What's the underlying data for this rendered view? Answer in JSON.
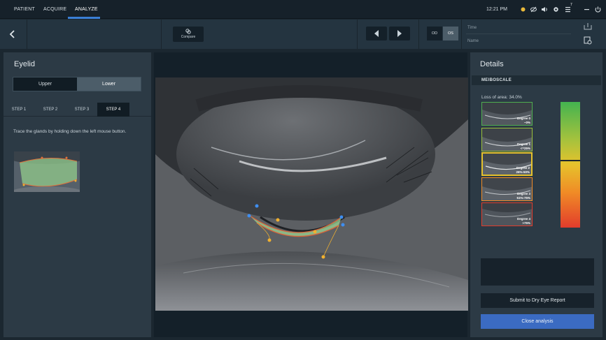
{
  "topnav": {
    "tabs": [
      {
        "label": "PATIENT"
      },
      {
        "label": "ACQUIRE"
      },
      {
        "label": "ANALYZE"
      }
    ],
    "time": "12:21 PM",
    "notification_count": "7",
    "accent_color": "#3a7fd6"
  },
  "toolbar": {
    "compare_label": "Compare",
    "eye_od": "OD",
    "eye_os": "OS",
    "time_label": "Time",
    "name_label": "Name"
  },
  "left_panel": {
    "title": "Eyelid",
    "lid_options": [
      "Upper",
      "Lower"
    ],
    "selected_lid": "Lower",
    "steps": [
      "STEP 1",
      "STEP 2",
      "STEP 3",
      "STEP 4"
    ],
    "active_step": "STEP 4",
    "instruction": "Trace the glands by holding down the left mouse button."
  },
  "right_panel": {
    "title": "Details",
    "section": "MEIBOSCALE",
    "loss_of_area": "Loss of area: 34.0%",
    "grades": [
      {
        "name": "Degree 0",
        "range": "~0%",
        "border": "#4fae4f"
      },
      {
        "name": "Degree 1",
        "range": "<=25%",
        "border": "#9abf3b"
      },
      {
        "name": "Degree 2",
        "range": "26%-50%",
        "border": "#e5c12b"
      },
      {
        "name": "Degree 3",
        "range": "51%-75%",
        "border": "#f08b26"
      },
      {
        "name": "Degree 4",
        "range": ">75%",
        "border": "#e23c2c"
      }
    ],
    "selected_grade": "Degree 2",
    "scale_marker_fraction": 0.46,
    "submit_label": "Submit to Dry Eye Report",
    "close_label": "Close analysis",
    "close_color": "#3b6bc2"
  }
}
